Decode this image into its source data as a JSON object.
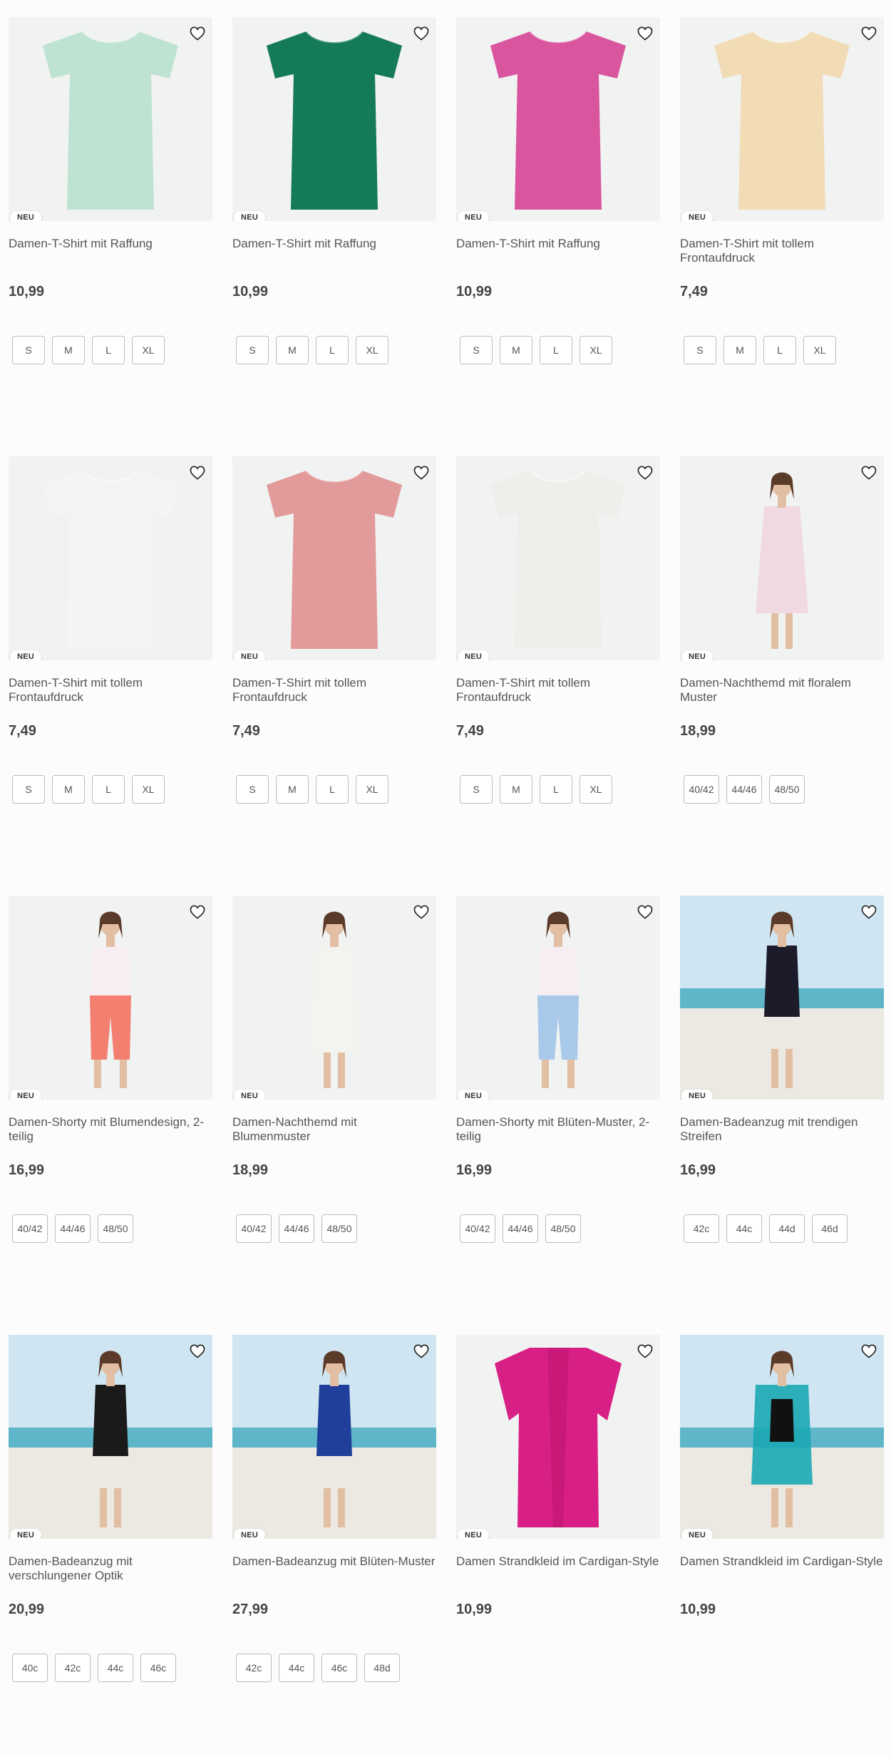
{
  "badge": "NEU",
  "products": [
    {
      "title": "Damen-T-Shirt mit Raffung",
      "price": "10,99",
      "sizes": [
        "S",
        "M",
        "L",
        "XL"
      ],
      "image": "mint-floral-tshirt",
      "color": "#bfe3d2"
    },
    {
      "title": "Damen-T-Shirt mit Raffung",
      "price": "10,99",
      "sizes": [
        "S",
        "M",
        "L",
        "XL"
      ],
      "image": "green-floral-tshirt",
      "color": "#157a5a"
    },
    {
      "title": "Damen-T-Shirt mit Raffung",
      "price": "10,99",
      "sizes": [
        "S",
        "M",
        "L",
        "XL"
      ],
      "image": "pink-floral-tshirt",
      "color": "#d9569f"
    },
    {
      "title": "Damen-T-Shirt mit tollem Frontaufdruck",
      "price": "7,49",
      "sizes": [
        "S",
        "M",
        "L",
        "XL"
      ],
      "image": "beige-mandala-tshirt",
      "color": "#f1dcb6"
    },
    {
      "title": "Damen-T-Shirt mit tollem Frontaufdruck",
      "price": "7,49",
      "sizes": [
        "S",
        "M",
        "L",
        "XL"
      ],
      "image": "white-fabulous-tshirt",
      "color": "#f4f4f6"
    },
    {
      "title": "Damen-T-Shirt mit tollem Frontaufdruck",
      "price": "7,49",
      "sizes": [
        "S",
        "M",
        "L",
        "XL"
      ],
      "image": "rose-love-tshirt",
      "color": "#e39a9a"
    },
    {
      "title": "Damen-T-Shirt mit tollem Frontaufdruck",
      "price": "7,49",
      "sizes": [
        "S",
        "M",
        "L",
        "XL"
      ],
      "image": "white-journey-tshirt",
      "color": "#efeeea"
    },
    {
      "title": "Damen-Nachthemd mit floralem Muster",
      "price": "18,99",
      "sizes": [
        "40/42",
        "44/46",
        "48/50"
      ],
      "image": "floral-nightdress",
      "color": "#f0d9e2"
    },
    {
      "title": "Damen-Shorty mit Blumendesign, 2-teilig",
      "price": "16,99",
      "sizes": [
        "40/42",
        "44/46",
        "48/50"
      ],
      "image": "coral-shorty-set",
      "color": "#f27f6f"
    },
    {
      "title": "Damen-Nachthemd mit Blumenmuster",
      "price": "18,99",
      "sizes": [
        "40/42",
        "44/46",
        "48/50"
      ],
      "image": "white-nightdress",
      "color": "#f3f3f0"
    },
    {
      "title": "Damen-Shorty mit Blüten-Muster, 2-teilig",
      "price": "16,99",
      "sizes": [
        "40/42",
        "44/46",
        "48/50"
      ],
      "image": "blue-shorty-set",
      "color": "#a8c9ea"
    },
    {
      "title": "Damen-Badeanzug mit trendigen Streifen",
      "price": "16,99",
      "sizes": [
        "42c",
        "44c",
        "44d",
        "46d"
      ],
      "image": "striped-swimsuit",
      "color": "#1b1b2a"
    },
    {
      "title": "Damen-Badeanzug mit verschlungener Optik",
      "price": "20,99",
      "sizes": [
        "40c",
        "42c",
        "44c",
        "46c"
      ],
      "image": "black-swimsuit",
      "color": "#1a1a1a"
    },
    {
      "title": "Damen-Badeanzug mit Blüten-Muster",
      "price": "27,99",
      "sizes": [
        "42c",
        "44c",
        "46c",
        "48d"
      ],
      "image": "blue-floral-swimsuit",
      "color": "#1f3f9a"
    },
    {
      "title": "Damen Strandkleid im Cardigan-Style",
      "price": "10,99",
      "sizes": [],
      "image": "pink-beach-cardigan",
      "color": "#d81f85"
    },
    {
      "title": "Damen Strandkleid im Cardigan-Style",
      "price": "10,99",
      "sizes": [],
      "image": "teal-beach-cardigan",
      "color": "#1ba9b4"
    }
  ]
}
